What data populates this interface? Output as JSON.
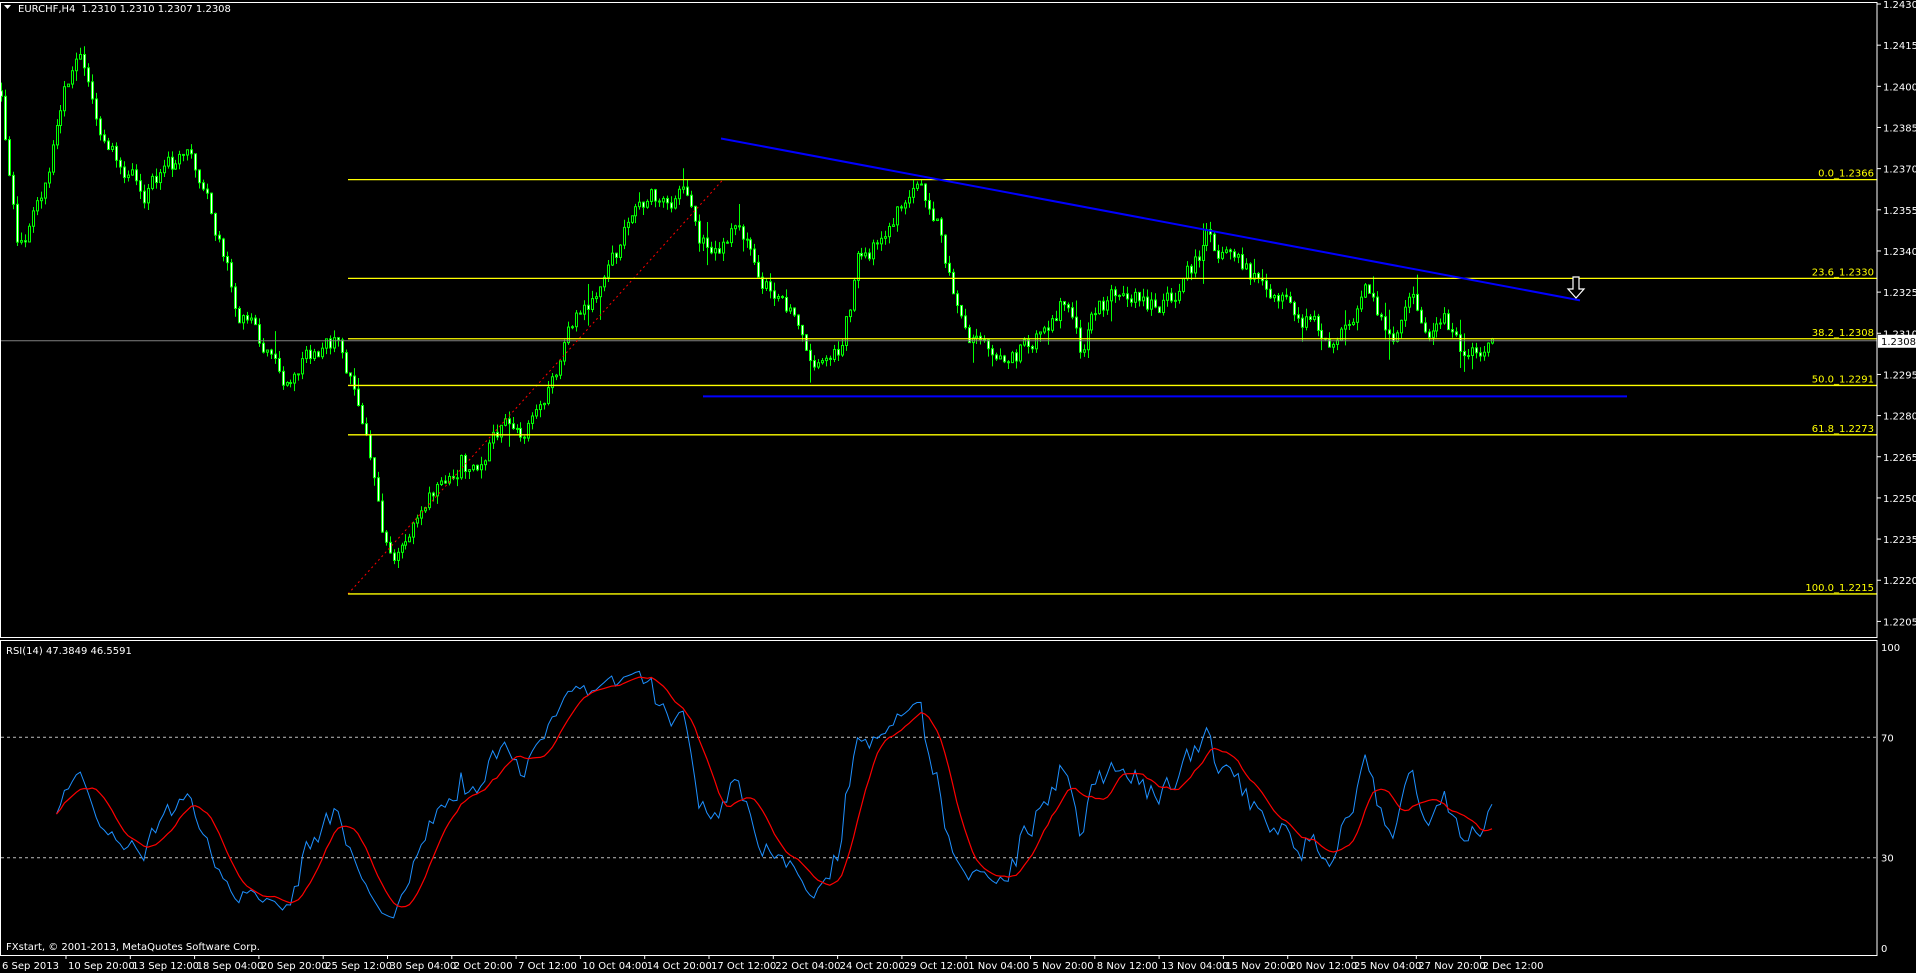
{
  "header": {
    "symbol_tf": "EURCHF,H4",
    "ohlc": "1.2310 1.2310 1.2307 1.2308"
  },
  "copyright": "FXstart, © 2001-2013, MetaQuotes Software Corp.",
  "colors": {
    "background": "#000000",
    "candle": "#00ff00",
    "bear_fill": "#ffffff",
    "fib": "#ffff00",
    "trendline": "#0000ff",
    "fib_trend": "#ff0000",
    "rsi": "#1e90ff",
    "rsi_signal": "#ff0000",
    "axis": "#ffffff",
    "price_line": "#808080"
  },
  "chart_data": [
    {
      "type": "candlestick",
      "title": "EURCHF,H4",
      "timeframe": "H4",
      "ylim": [
        1.2198,
        1.2432
      ],
      "y_ticks": [
        "1.2430",
        "1.2415",
        "1.2400",
        "1.2385",
        "1.2370",
        "1.2355",
        "1.2340",
        "1.2325",
        "1.2310",
        "1.2295",
        "1.2280",
        "1.2265",
        "1.2250",
        "1.2235",
        "1.2220",
        "1.2205"
      ],
      "x_ticks": [
        "6 Sep 2013",
        "10 Sep 20:00",
        "13 Sep 12:00",
        "18 Sep 04:00",
        "20 Sep 20:00",
        "25 Sep 12:00",
        "30 Sep 04:00",
        "2 Oct 20:00",
        "7 Oct 12:00",
        "10 Oct 04:00",
        "14 Oct 20:00",
        "17 Oct 12:00",
        "22 Oct 04:00",
        "24 Oct 20:00",
        "29 Oct 12:00",
        "1 Nov 04:00",
        "5 Nov 20:00",
        "8 Nov 12:00",
        "13 Nov 04:00",
        "15 Nov 20:00",
        "20 Nov 12:00",
        "25 Nov 04:00",
        "27 Nov 20:00",
        "2 Dec 12:00"
      ],
      "close_samples": [
        1.2393,
        1.2342,
        1.2351,
        1.2364,
        1.24,
        1.2409,
        1.2387,
        1.2378,
        1.2369,
        1.2362,
        1.2369,
        1.2372,
        1.2374,
        1.236,
        1.2338,
        1.2318,
        1.2313,
        1.2298,
        1.2293,
        1.23,
        1.2302,
        1.2306,
        1.2295,
        1.2269,
        1.2235,
        1.2228,
        1.2244,
        1.2251,
        1.2253,
        1.2264,
        1.2257,
        1.2275,
        1.228,
        1.2272,
        1.228,
        1.2293,
        1.2313,
        1.2319,
        1.2335,
        1.2343,
        1.2355,
        1.2359,
        1.2358,
        1.236,
        1.2344,
        1.2342,
        1.2346,
        1.2341,
        1.233,
        1.2326,
        1.2318,
        1.2298,
        1.2306,
        1.2306,
        1.2335,
        1.2341,
        1.2351,
        1.2362,
        1.2362,
        1.2351,
        1.2324,
        1.2306,
        1.2304,
        1.2303,
        1.2303,
        1.2308,
        1.231,
        1.2322,
        1.2302,
        1.2318,
        1.2323,
        1.2324,
        1.2322,
        1.2318,
        1.2321,
        1.2333,
        1.2344,
        1.234,
        1.2335,
        1.2331,
        1.2327,
        1.2323,
        1.2317,
        1.2312,
        1.2304,
        1.2311,
        1.2323,
        1.2314,
        1.231,
        1.2322,
        1.2311,
        1.2316,
        1.2306,
        1.2305,
        1.2308
      ],
      "bid": "1.2308",
      "fibonacci": [
        {
          "label": "0.0_1.2366",
          "price": 1.2366
        },
        {
          "label": "23.6_1.2330",
          "price": 1.233
        },
        {
          "label": "38.2_1.2308",
          "price": 1.2308
        },
        {
          "label": "50.0_1.2291",
          "price": 1.2291
        },
        {
          "label": "61.8_1.2273",
          "price": 1.2273
        },
        {
          "label": "100.0_1.2215",
          "price": 1.2215
        }
      ],
      "support_price": 1.2287,
      "resistance_trend": [
        1.2381,
        1.2322
      ],
      "annotation": "down-arrow-icon"
    },
    {
      "type": "line",
      "title": "RSI(14) 47.3849 46.5591",
      "ylim": [
        0,
        100
      ],
      "y_ticks": [
        "100",
        "70",
        "30",
        "0"
      ],
      "levels": [
        70,
        30
      ],
      "period": 14,
      "last_values": [
        47.3849,
        46.5591
      ]
    }
  ]
}
